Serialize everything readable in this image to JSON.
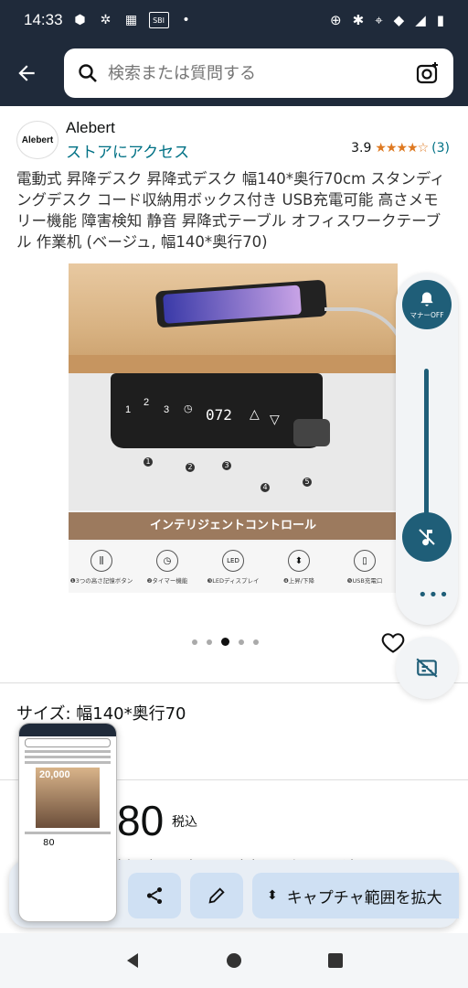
{
  "status_bar": {
    "time": "14:33",
    "left_icons": [
      "app-icon",
      "pinwheel-icon",
      "calendar-icon",
      "sbi-icon",
      "dot-icon"
    ],
    "sbi_label": "SBI",
    "right_icons": [
      "sync-icon",
      "bluetooth-icon",
      "location-icon",
      "wifi-icon",
      "signal-icon",
      "battery-icon"
    ]
  },
  "header": {
    "search_placeholder": "検索または質問する"
  },
  "store": {
    "logo_text": "Alebert",
    "brand": "Alebert",
    "visit_link": "ストアにアクセス",
    "rating": "3.9",
    "stars": "★★★★☆",
    "review_count": "(3)"
  },
  "product": {
    "title": "電動式 昇降デスク 昇降式デスク 幅140*奥行70cm スタンディングデスク コード収納用ボックス付き USB充電可能 高さメモリー機能 障害検知 静音 昇降式テーブル オフィスワークテーブル 作業机 (ベージュ, 幅140*奥行70)",
    "image": {
      "display": "072",
      "buttons": [
        "1",
        "2",
        "3"
      ],
      "callouts": [
        "1",
        "2",
        "3",
        "4",
        "5"
      ],
      "banner": "インテリジェントコントロール",
      "features": [
        {
          "icon": "memory-buttons-icon",
          "label": "❶3つの高さ記憶ボタン"
        },
        {
          "icon": "timer-icon",
          "label": "❷タイマー機能"
        },
        {
          "icon": "led-icon",
          "label": "❸LEDディスプレイ"
        },
        {
          "icon": "up-down-icon",
          "label": "❹上昇/下降"
        },
        {
          "icon": "usb-icon",
          "label": "❺USB充電口"
        }
      ],
      "led_text": "LED"
    },
    "carousel": {
      "count": 5,
      "active_index": 2
    },
    "size_label": "サイズ: 幅140*奥行70",
    "price": "80",
    "tax_label": "税込",
    "promo_text": "追加時に選択した支払いプランを適用で"
  },
  "accessibility_panel": {
    "manner_label": "マナーOFF",
    "more_label": "•••"
  },
  "screenshot_toolbar": {
    "expand_label": "キャプチャ範囲を拡大",
    "thumbnail_badge": "20,000",
    "thumbnail_price": "80"
  },
  "colors": {
    "header_bg": "#1f2a3a",
    "link": "#007185",
    "stars": "#de7921",
    "panel_accent": "#1f5e78",
    "toolbar_button": "#cfe0f3"
  }
}
